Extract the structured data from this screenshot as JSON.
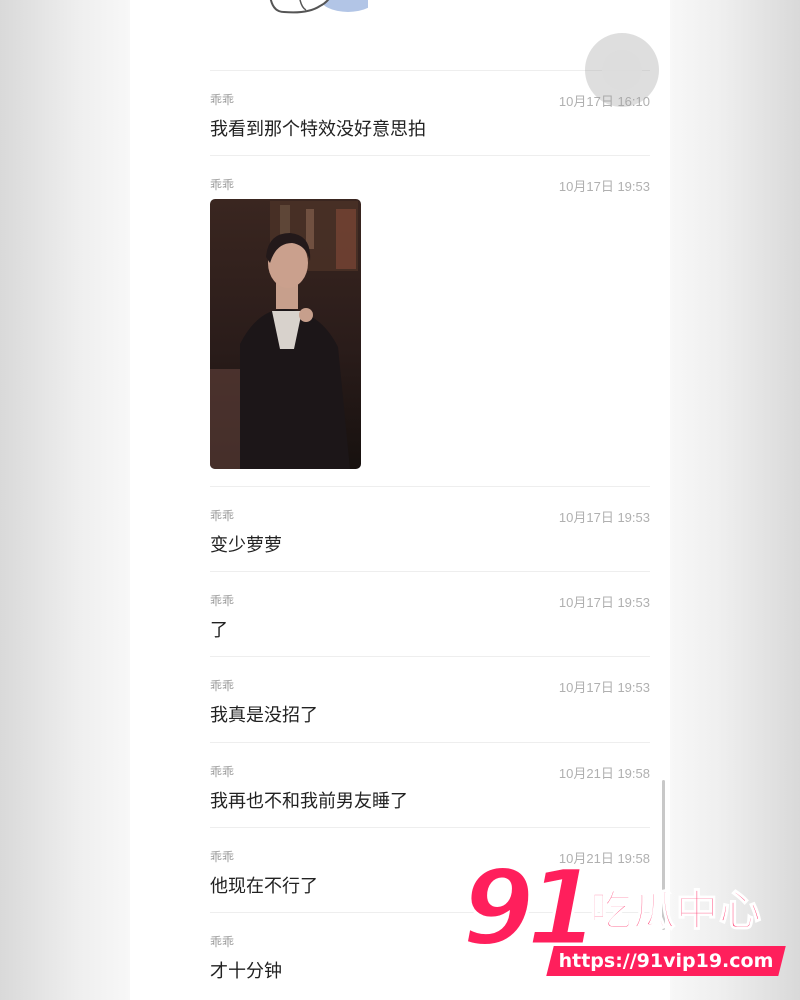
{
  "messages": [
    {
      "sender": "乖乖",
      "time": "10月17日 16:10",
      "text": "我看到那个特效没好意思拍"
    },
    {
      "sender": "乖乖",
      "time": "10月17日 19:53",
      "type": "image"
    },
    {
      "sender": "乖乖",
      "time": "10月17日 19:53",
      "text": "变少萝萝"
    },
    {
      "sender": "乖乖",
      "time": "10月17日 19:53",
      "text": "了"
    },
    {
      "sender": "乖乖",
      "time": "10月17日 19:53",
      "text": "我真是没招了"
    },
    {
      "sender": "乖乖",
      "time": "10月21日 19:58",
      "text": "我再也不和我前男友睡了"
    },
    {
      "sender": "乖乖",
      "time": "10月21日 19:58",
      "text": "他现在不行了"
    },
    {
      "sender": "乖乖",
      "time": "",
      "text": "才十分钟"
    }
  ],
  "watermark": {
    "number": "91",
    "brand": "吃瓜中心",
    "url": "https://91vip19.com"
  },
  "colors": {
    "watermark": "#ff1f5c",
    "text": "#222222",
    "meta": "#9a9a9a"
  }
}
